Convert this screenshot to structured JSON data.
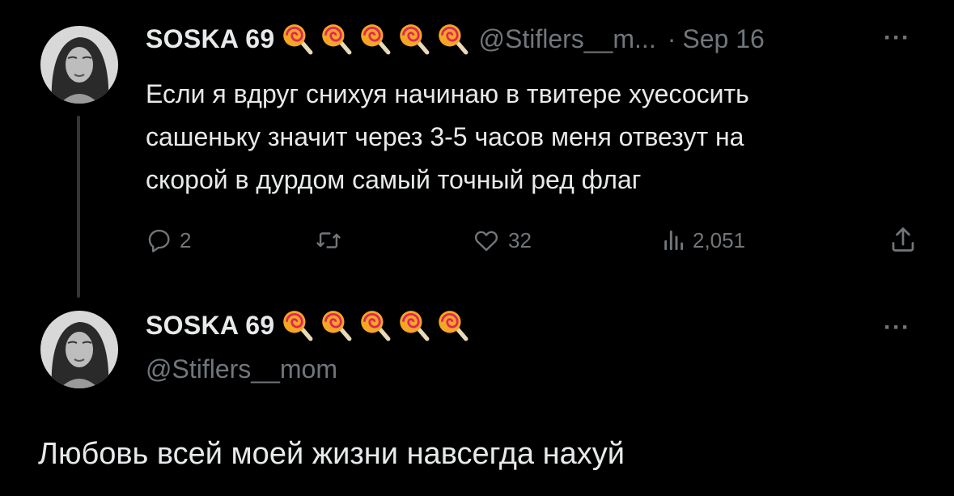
{
  "reply_to_tweet": {
    "display_name": "SOSKA 69",
    "emoji_count": 5,
    "emoji_icon": "lollipop-icon",
    "handle": "@Stiflers__m...",
    "dot": "·",
    "date": "Sep 16",
    "more": "···",
    "text_lines": [
      "Если я вдруг снихуя начинаю в твитере хуесосить",
      "сашеньку значит через 3-5 часов меня отвезут на",
      "скорой в дурдом самый точный ред флаг"
    ],
    "actions": {
      "reply_count": "2",
      "retweet_count": "",
      "like_count": "32",
      "views_count": "2,051"
    }
  },
  "main_tweet": {
    "display_name": "SOSKA 69",
    "emoji_count": 5,
    "emoji_icon": "lollipop-icon",
    "handle": "@Stiflers__mom",
    "more": "···",
    "text": "Любовь всей моей жизни навсегда нахуй"
  },
  "colors": {
    "background": "#000000",
    "text_primary": "#e7e9ea",
    "text_secondary": "#71767b",
    "thread_line": "#333639"
  }
}
